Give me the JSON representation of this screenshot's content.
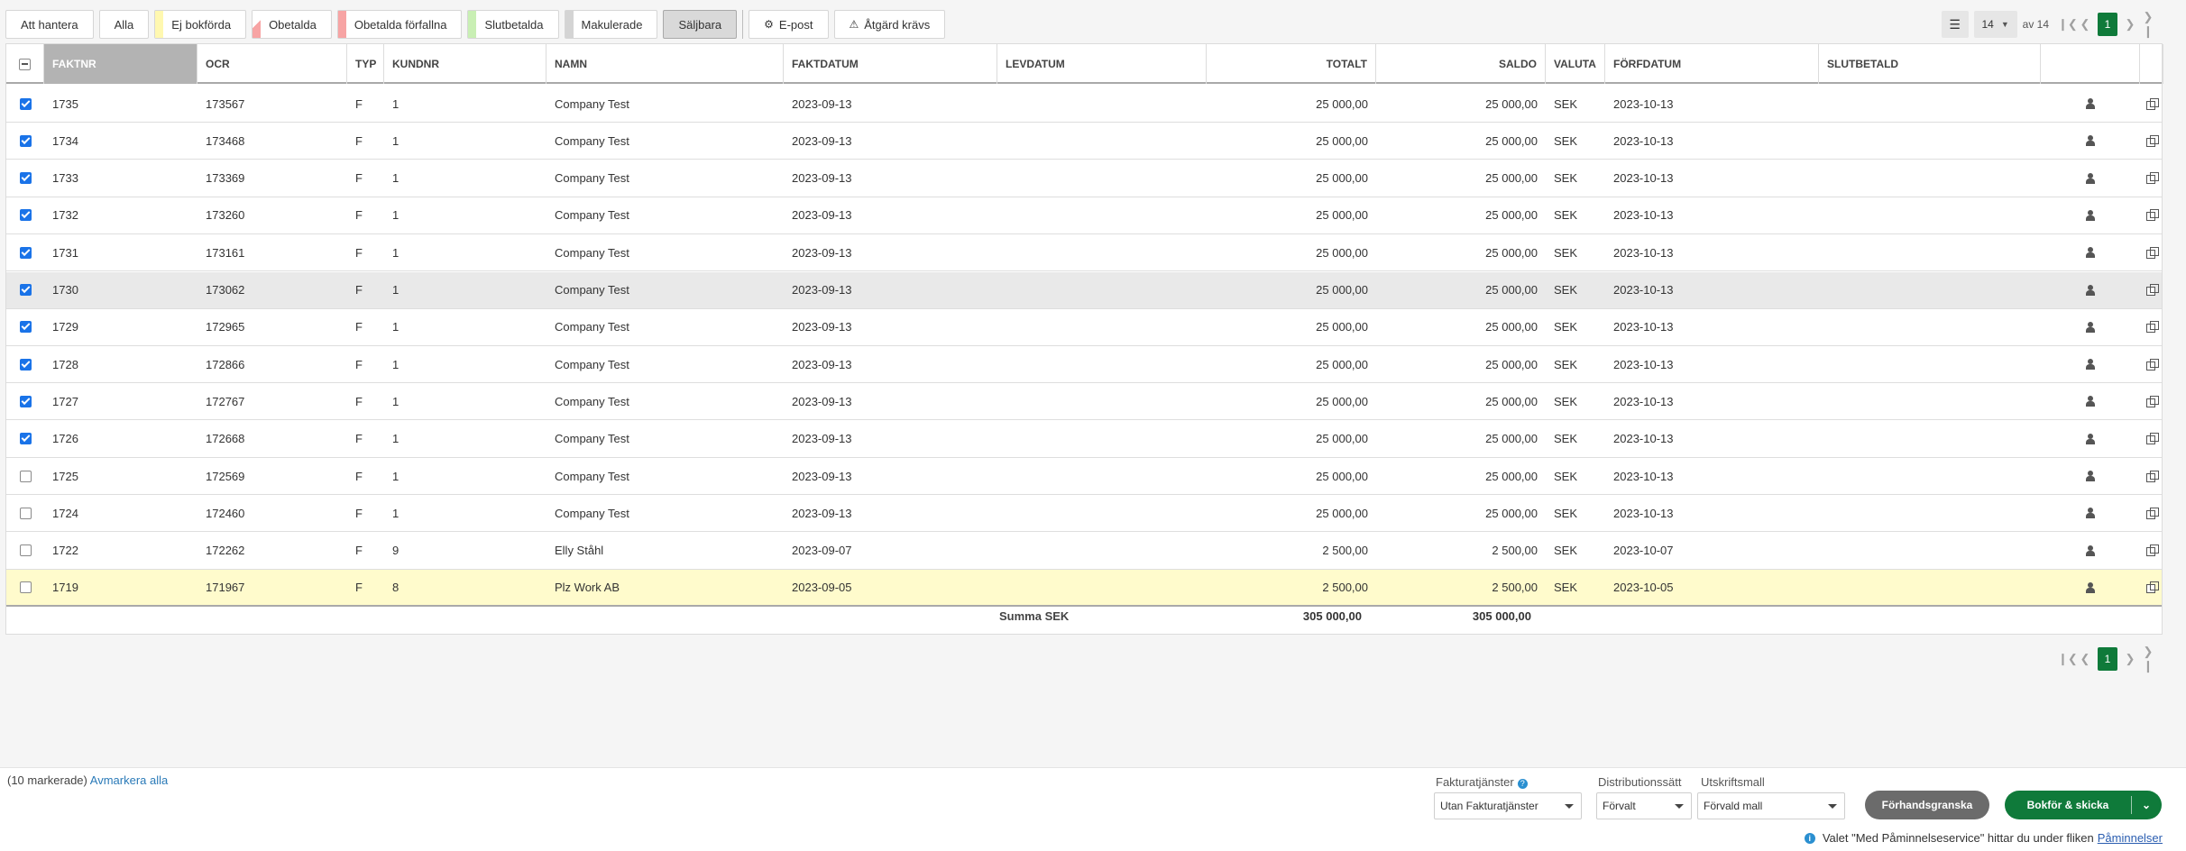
{
  "toolbar": {
    "filters": [
      {
        "label": "Att hantera",
        "strip": null,
        "active": false
      },
      {
        "label": "Alla",
        "strip": null,
        "active": false
      },
      {
        "label": "Ej bokförda",
        "strip": "#fff8b0",
        "active": false
      },
      {
        "label": "Obetalda",
        "strip": "diag",
        "active": false
      },
      {
        "label": "Obetalda förfallna",
        "strip": "#f7a4a4",
        "active": false
      },
      {
        "label": "Slutbetalda",
        "strip": "#c9efb4",
        "active": false
      },
      {
        "label": "Makulerade",
        "strip": "#d4d4d4",
        "active": false
      },
      {
        "label": "Säljbara",
        "strip": null,
        "active": true
      }
    ],
    "actions": [
      {
        "label": "E-post",
        "icon": "gear-icon"
      },
      {
        "label": "Åtgärd krävs",
        "icon": "warning-icon"
      }
    ]
  },
  "pager": {
    "page_size": "14",
    "of_text": "av 14",
    "current": "1"
  },
  "columns": [
    "FAKTNR",
    "OCR",
    "TYP",
    "KUNDNR",
    "NAMN",
    "FAKTDATUM",
    "LEVDATUM",
    "TOTALT",
    "SALDO",
    "VALUTA",
    "FÖRFDATUM",
    "SLUTBETALD"
  ],
  "rows": [
    {
      "checked": true,
      "faktnr": "1735",
      "ocr": "173567",
      "typ": "F",
      "kundnr": "1",
      "namn": "Company Test",
      "faktdatum": "2023-09-13",
      "levdatum": "",
      "totalt": "25 000,00",
      "saldo": "25 000,00",
      "valuta": "SEK",
      "forfdatum": "2023-10-13",
      "slutbetald": ""
    },
    {
      "checked": true,
      "faktnr": "1734",
      "ocr": "173468",
      "typ": "F",
      "kundnr": "1",
      "namn": "Company Test",
      "faktdatum": "2023-09-13",
      "levdatum": "",
      "totalt": "25 000,00",
      "saldo": "25 000,00",
      "valuta": "SEK",
      "forfdatum": "2023-10-13",
      "slutbetald": ""
    },
    {
      "checked": true,
      "faktnr": "1733",
      "ocr": "173369",
      "typ": "F",
      "kundnr": "1",
      "namn": "Company Test",
      "faktdatum": "2023-09-13",
      "levdatum": "",
      "totalt": "25 000,00",
      "saldo": "25 000,00",
      "valuta": "SEK",
      "forfdatum": "2023-10-13",
      "slutbetald": ""
    },
    {
      "checked": true,
      "faktnr": "1732",
      "ocr": "173260",
      "typ": "F",
      "kundnr": "1",
      "namn": "Company Test",
      "faktdatum": "2023-09-13",
      "levdatum": "",
      "totalt": "25 000,00",
      "saldo": "25 000,00",
      "valuta": "SEK",
      "forfdatum": "2023-10-13",
      "slutbetald": ""
    },
    {
      "checked": true,
      "faktnr": "1731",
      "ocr": "173161",
      "typ": "F",
      "kundnr": "1",
      "namn": "Company Test",
      "faktdatum": "2023-09-13",
      "levdatum": "",
      "totalt": "25 000,00",
      "saldo": "25 000,00",
      "valuta": "SEK",
      "forfdatum": "2023-10-13",
      "slutbetald": ""
    },
    {
      "checked": true,
      "faktnr": "1730",
      "ocr": "173062",
      "typ": "F",
      "kundnr": "1",
      "namn": "Company Test",
      "faktdatum": "2023-09-13",
      "levdatum": "",
      "totalt": "25 000,00",
      "saldo": "25 000,00",
      "valuta": "SEK",
      "forfdatum": "2023-10-13",
      "slutbetald": "",
      "hover": true
    },
    {
      "checked": true,
      "faktnr": "1729",
      "ocr": "172965",
      "typ": "F",
      "kundnr": "1",
      "namn": "Company Test",
      "faktdatum": "2023-09-13",
      "levdatum": "",
      "totalt": "25 000,00",
      "saldo": "25 000,00",
      "valuta": "SEK",
      "forfdatum": "2023-10-13",
      "slutbetald": ""
    },
    {
      "checked": true,
      "faktnr": "1728",
      "ocr": "172866",
      "typ": "F",
      "kundnr": "1",
      "namn": "Company Test",
      "faktdatum": "2023-09-13",
      "levdatum": "",
      "totalt": "25 000,00",
      "saldo": "25 000,00",
      "valuta": "SEK",
      "forfdatum": "2023-10-13",
      "slutbetald": ""
    },
    {
      "checked": true,
      "faktnr": "1727",
      "ocr": "172767",
      "typ": "F",
      "kundnr": "1",
      "namn": "Company Test",
      "faktdatum": "2023-09-13",
      "levdatum": "",
      "totalt": "25 000,00",
      "saldo": "25 000,00",
      "valuta": "SEK",
      "forfdatum": "2023-10-13",
      "slutbetald": ""
    },
    {
      "checked": true,
      "faktnr": "1726",
      "ocr": "172668",
      "typ": "F",
      "kundnr": "1",
      "namn": "Company Test",
      "faktdatum": "2023-09-13",
      "levdatum": "",
      "totalt": "25 000,00",
      "saldo": "25 000,00",
      "valuta": "SEK",
      "forfdatum": "2023-10-13",
      "slutbetald": ""
    },
    {
      "checked": false,
      "faktnr": "1725",
      "ocr": "172569",
      "typ": "F",
      "kundnr": "1",
      "namn": "Company Test",
      "faktdatum": "2023-09-13",
      "levdatum": "",
      "totalt": "25 000,00",
      "saldo": "25 000,00",
      "valuta": "SEK",
      "forfdatum": "2023-10-13",
      "slutbetald": ""
    },
    {
      "checked": false,
      "faktnr": "1724",
      "ocr": "172460",
      "typ": "F",
      "kundnr": "1",
      "namn": "Company Test",
      "faktdatum": "2023-09-13",
      "levdatum": "",
      "totalt": "25 000,00",
      "saldo": "25 000,00",
      "valuta": "SEK",
      "forfdatum": "2023-10-13",
      "slutbetald": ""
    },
    {
      "checked": false,
      "faktnr": "1722",
      "ocr": "172262",
      "typ": "F",
      "kundnr": "9",
      "namn": "Elly Ståhl",
      "faktdatum": "2023-09-07",
      "levdatum": "",
      "totalt": "2 500,00",
      "saldo": "2 500,00",
      "valuta": "SEK",
      "forfdatum": "2023-10-07",
      "slutbetald": ""
    },
    {
      "checked": false,
      "faktnr": "1719",
      "ocr": "171967",
      "typ": "F",
      "kundnr": "8",
      "namn": "Plz Work AB",
      "faktdatum": "2023-09-05",
      "levdatum": "",
      "totalt": "2 500,00",
      "saldo": "2 500,00",
      "valuta": "SEK",
      "forfdatum": "2023-10-05",
      "slutbetald": "",
      "yellow": true
    }
  ],
  "summary": {
    "label": "Summa SEK",
    "totalt": "305 000,00",
    "saldo": "305 000,00"
  },
  "bottom": {
    "selected_text": "(10 markerade)",
    "deselect_link": "Avmarkera alla",
    "fakturatjanster_label": "Fakturatjänster",
    "fakturatjanster_value": "Utan Fakturatjänster",
    "distribution_label": "Distributionssätt",
    "distribution_value": "Förvalt",
    "utskrift_label": "Utskriftsmall",
    "utskrift_value": "Förvald mall",
    "preview_label": "Förhandsgranska",
    "post_label": "Bokför & skicka",
    "notice_text": "Valet \"Med Påminnelseservice\" hittar du under fliken",
    "notice_link": "Påminnelser"
  },
  "colors": {
    "accent": "#0f7a3a",
    "checkbox": "#1a73e8",
    "highlight_row": "#fffbcc"
  }
}
